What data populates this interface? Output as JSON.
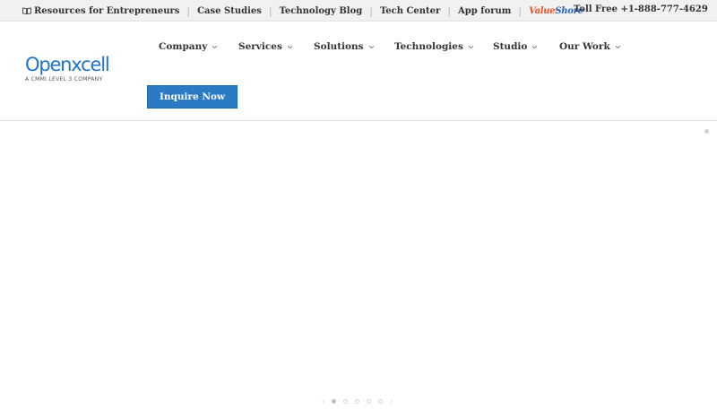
{
  "topbar": {
    "links": [
      {
        "label": "Resources for Entrepreneurs",
        "icon": "book-icon"
      },
      {
        "label": "Case Studies"
      },
      {
        "label": "Technology Blog"
      },
      {
        "label": "Tech Center"
      },
      {
        "label": "App forum"
      }
    ],
    "valueshore": {
      "part1": "Value",
      "part2": "Shore"
    },
    "toll_free": "Toll Free +1-888-777-4629"
  },
  "logo": {
    "name": "Openxcell",
    "tagline": "A CMMI LEVEL 3 COMPANY",
    "color": "#1f74c9"
  },
  "nav": {
    "items": [
      {
        "label": "Company"
      },
      {
        "label": "Services"
      },
      {
        "label": "Solutions"
      },
      {
        "label": "Technologies"
      },
      {
        "label": "Studio"
      },
      {
        "label": "Our Work"
      }
    ],
    "cta": "Inquire Now",
    "cta_color": "#2a7bc4"
  },
  "slider": {
    "prev_arrow": "‹",
    "next_arrow": "›",
    "dot_count": 5,
    "active_dot": 1
  }
}
